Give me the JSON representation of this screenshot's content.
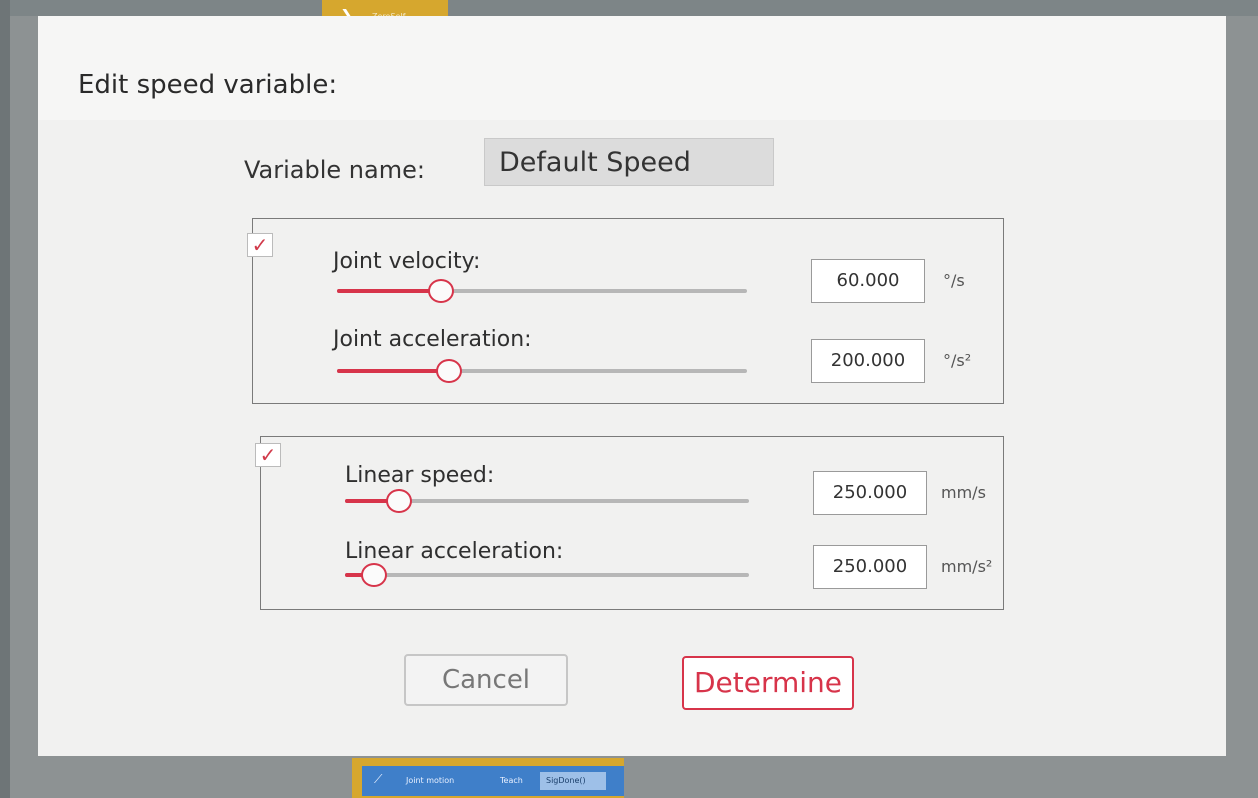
{
  "background": {
    "top_tab_label": "ZeroSelf",
    "bottom_bar": {
      "mode_label": "Joint motion",
      "teach_label": "Teach",
      "field_value": "SigDone()"
    }
  },
  "dialog": {
    "title": "Edit speed variable:",
    "variable_name_label": "Variable name:",
    "variable_name_value": "Default Speed",
    "joint_group": {
      "enabled": true,
      "sliders": [
        {
          "label": "Joint velocity:",
          "value": "60.000",
          "unit": "°/s",
          "fraction": 0.25
        },
        {
          "label": "Joint acceleration:",
          "value": "200.000",
          "unit": "°/s²",
          "fraction": 0.27
        }
      ]
    },
    "linear_group": {
      "enabled": true,
      "sliders": [
        {
          "label": "Linear speed:",
          "value": "250.000",
          "unit": "mm/s",
          "fraction": 0.13
        },
        {
          "label": "Linear acceleration:",
          "value": "250.000",
          "unit": "mm/s²",
          "fraction": 0.07
        }
      ]
    },
    "cancel_label": "Cancel",
    "determine_label": "Determine"
  },
  "colors": {
    "accent": "#d7344a",
    "dialog_bg": "#f1f1f0"
  },
  "icons": {
    "checkbox": "checkmark-icon",
    "top_tab": "chevron-right-icon"
  }
}
